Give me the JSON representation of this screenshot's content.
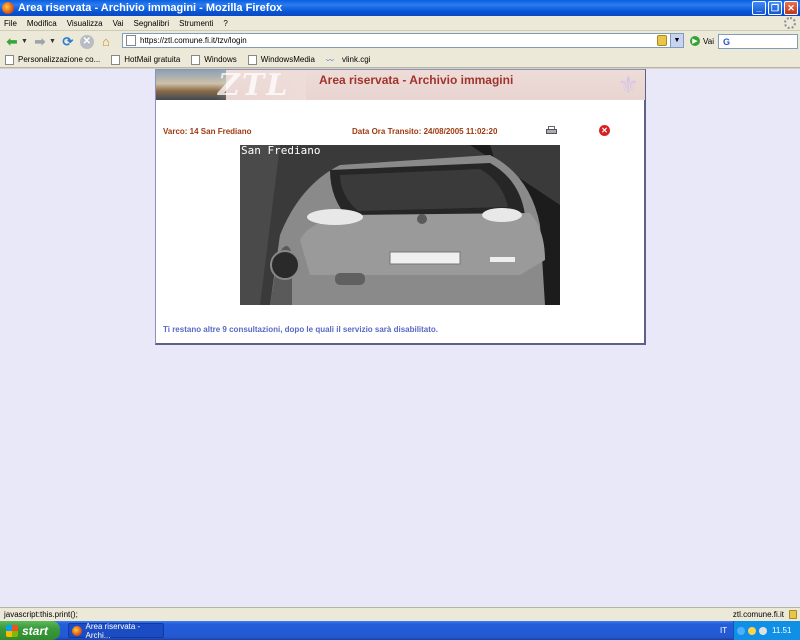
{
  "window": {
    "title": "Area riservata - Archivio immagini - Mozilla Firefox",
    "buttons": [
      "_",
      "❐",
      "✕"
    ]
  },
  "menu": [
    "File",
    "Modifica",
    "Visualizza",
    "Vai",
    "Segnalibri",
    "Strumenti",
    "?"
  ],
  "nav": {
    "url": "https://ztl.comune.fi.it/tzv/login",
    "go_label": "Vai",
    "search_placeholder": "",
    "search_engine_icon": "G"
  },
  "bookmarks": [
    {
      "label": "Personalizzazione co...",
      "icon": "page-icon"
    },
    {
      "label": "HotMail gratuita",
      "icon": "page-icon"
    },
    {
      "label": "Windows",
      "icon": "page-icon"
    },
    {
      "label": "WindowsMedia",
      "icon": "page-icon"
    },
    {
      "label": "vlink.cgi",
      "icon": "wave-icon"
    }
  ],
  "page": {
    "banner_logo": "ZTL",
    "title": "Area riservata - Archivio immagini",
    "varco": "Varco: 14 San Frediano",
    "datetime": "Data Ora Transito: 24/08/2005 11:02:20",
    "camera_label": "San Frediano",
    "notice": "Ti restano altre 9 consultazioni, dopo le quali il servizio sarà disabilitato."
  },
  "status": {
    "text": "javascript:this.print();",
    "domain": "ztl.comune.fi.it"
  },
  "taskbar": {
    "start_label": "start",
    "task_label": "Area riservata - Archi...",
    "lang": "IT",
    "clock": "11.51"
  },
  "colors": {
    "title_red": "#a0342b",
    "info_orange": "#9d3a10",
    "notice_blue": "#5a68c4",
    "page_bg": "#e8e8f8"
  }
}
